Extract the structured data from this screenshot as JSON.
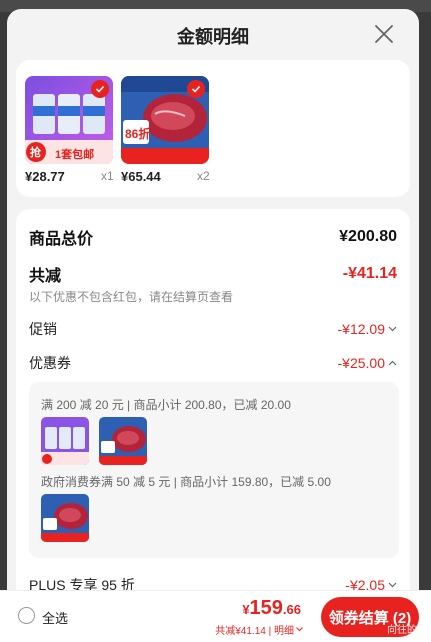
{
  "sheet": {
    "title": "金额明细"
  },
  "products": [
    {
      "price": "¥28.77",
      "qty": "x1",
      "image": "product-image-tissue",
      "promo_tag": "1套包邮",
      "promo_corner": "抢"
    },
    {
      "price": "¥65.44",
      "qty": "x2",
      "image": "product-image-beef",
      "discount_tag": "86折"
    }
  ],
  "summary": {
    "total_label": "商品总价",
    "total_value": "¥200.80",
    "reduce_label": "共减",
    "reduce_value": "-¥41.14",
    "reduce_note": "以下优惠不包含红包，请在结算页查看",
    "promo_label": "促销",
    "promo_value": "-¥12.09",
    "coupon_label": "优惠券",
    "coupon_value": "-¥25.00",
    "coupon_line1": "满 200 减 20 元 | 商品小计 200.80，已减 20.00",
    "coupon_line2": "政府消费券满 50 减 5 元 | 商品小计 159.80，已减 5.00",
    "plus_label": "PLUS 专享 95 折",
    "plus_value": "-¥2.05"
  },
  "bottom": {
    "select_all": "全选",
    "price_symbol": "¥",
    "price_int": "159",
    "price_dec": ".66",
    "sub_text": "共减¥41.14 | 明细",
    "pay_button": "领券结算 (2)",
    "watermark": "向往的生"
  },
  "colors": {
    "accent": "#e8231f",
    "background": "#f3f3f3"
  }
}
